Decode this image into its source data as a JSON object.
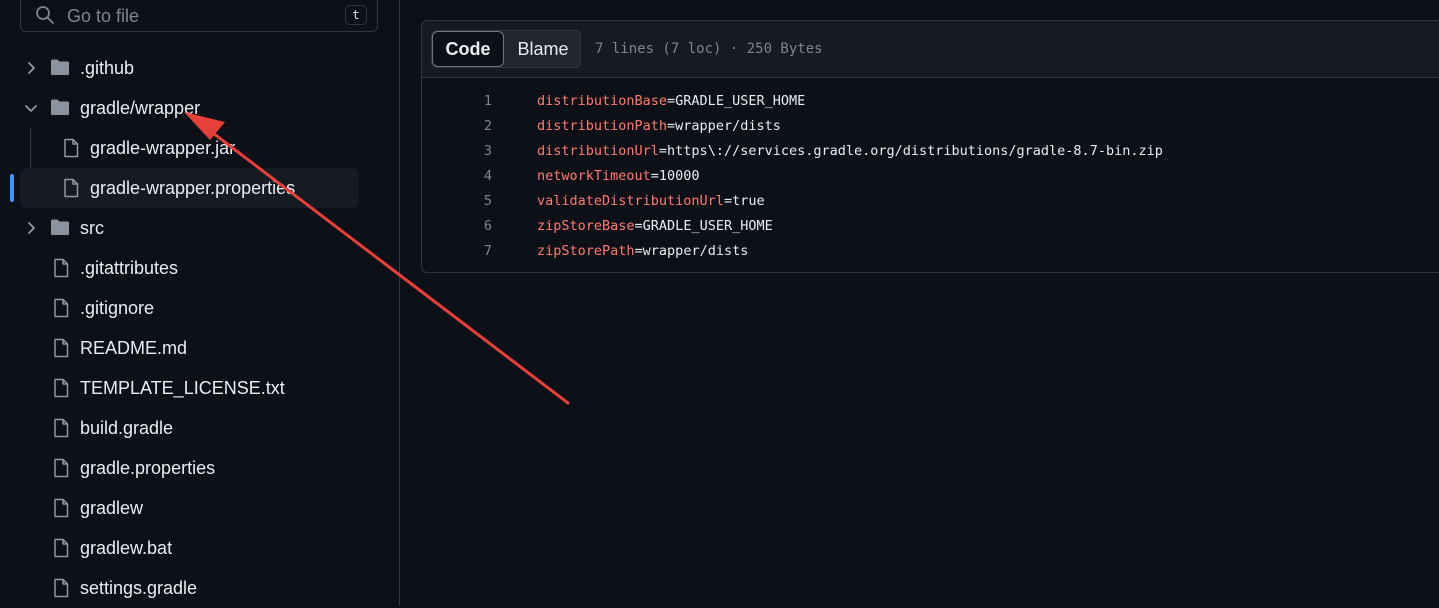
{
  "search": {
    "placeholder": "Go to file",
    "shortcut": "t"
  },
  "tree": [
    {
      "type": "folder",
      "label": ".github",
      "expanded": false
    },
    {
      "type": "folder",
      "label": "gradle/wrapper",
      "expanded": true
    },
    {
      "type": "file",
      "label": "gradle-wrapper.jar",
      "nested": true
    },
    {
      "type": "file",
      "label": "gradle-wrapper.properties",
      "nested": true,
      "selected": true
    },
    {
      "type": "folder",
      "label": "src",
      "expanded": false
    },
    {
      "type": "file",
      "label": ".gitattributes"
    },
    {
      "type": "file",
      "label": ".gitignore"
    },
    {
      "type": "file",
      "label": "README.md"
    },
    {
      "type": "file",
      "label": "TEMPLATE_LICENSE.txt"
    },
    {
      "type": "file",
      "label": "build.gradle"
    },
    {
      "type": "file",
      "label": "gradle.properties"
    },
    {
      "type": "file",
      "label": "gradlew"
    },
    {
      "type": "file",
      "label": "gradlew.bat"
    },
    {
      "type": "file",
      "label": "settings.gradle"
    }
  ],
  "viewer": {
    "code_tab": "Code",
    "blame_tab": "Blame",
    "file_info": "7 lines (7 loc) · 250 Bytes",
    "lines": [
      {
        "num": "1",
        "key": "distributionBase",
        "value": "=GRADLE_USER_HOME"
      },
      {
        "num": "2",
        "key": "distributionPath",
        "value": "=wrapper/dists"
      },
      {
        "num": "3",
        "key": "distributionUrl",
        "value": "=https\\://services.gradle.org/distributions/gradle-8.7-bin.zip"
      },
      {
        "num": "4",
        "key": "networkTimeout",
        "value": "=10000"
      },
      {
        "num": "5",
        "key": "validateDistributionUrl",
        "value": "=true"
      },
      {
        "num": "6",
        "key": "zipStoreBase",
        "value": "=GRADLE_USER_HOME"
      },
      {
        "num": "7",
        "key": "zipStorePath",
        "value": "=wrapper/dists"
      }
    ]
  },
  "colors": {
    "accent": "#4493f8",
    "annotation": "#e5403a",
    "key": "#ff7b72"
  }
}
